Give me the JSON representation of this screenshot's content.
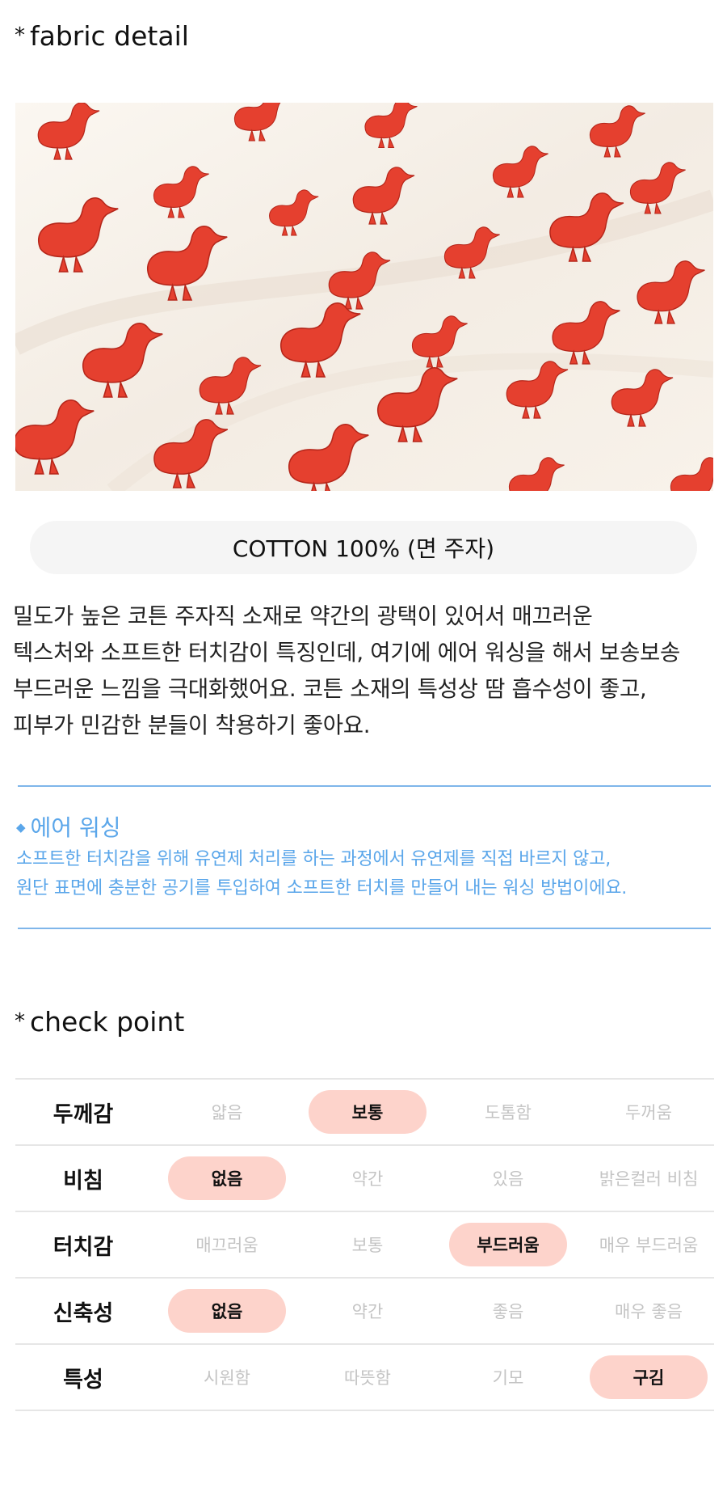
{
  "fabric_section": {
    "title": "fabric detail",
    "star": "*",
    "material_label": "COTTON 100% (면 주자)",
    "description_lines": [
      "밀도가 높은 코튼 주자직 소재로 약간의 광택이 있어서 매끄러운",
      "텍스처와 소프트한 터치감이 특징인데, 여기에 에어 워싱을 해서 보송보송",
      "부드러운 느낌을 극대화했어요. 코튼 소재의 특성상 땀 흡수성이 좋고,",
      "피부가 민감한 분들이 착용하기 좋아요."
    ]
  },
  "washing_info": {
    "bullet": "◆",
    "title": "에어 워싱",
    "lines": [
      "소프트한 터치감을 위해 유연제 처리를 하는 과정에서 유연제를 직접 바르지 않고,",
      "원단 표면에 충분한 공기를 투입하여 소프트한 터치를 만들어 내는 워싱 방법이에요."
    ]
  },
  "check_section": {
    "title": "check point",
    "star": "*",
    "rows": [
      {
        "label": "두께감",
        "options": [
          "얇음",
          "보통",
          "도톰함",
          "두꺼움"
        ],
        "selected": 1
      },
      {
        "label": "비침",
        "options": [
          "없음",
          "약간",
          "있음",
          "밝은컬러 비침"
        ],
        "selected": 0
      },
      {
        "label": "터치감",
        "options": [
          "매끄러움",
          "보통",
          "부드러움",
          "매우 부드러움"
        ],
        "selected": 2
      },
      {
        "label": "신축성",
        "options": [
          "없음",
          "약간",
          "좋음",
          "매우 좋음"
        ],
        "selected": 0
      },
      {
        "label": "특성",
        "options": [
          "시원함",
          "따뜻함",
          "기모",
          "구김"
        ],
        "selected": 3
      }
    ]
  },
  "colors": {
    "accent_blue": "#5aa6ea",
    "selected_pill": "#fdd3cb",
    "fabric_base": "#f7f1ea",
    "duck_red": "#e5402f"
  }
}
